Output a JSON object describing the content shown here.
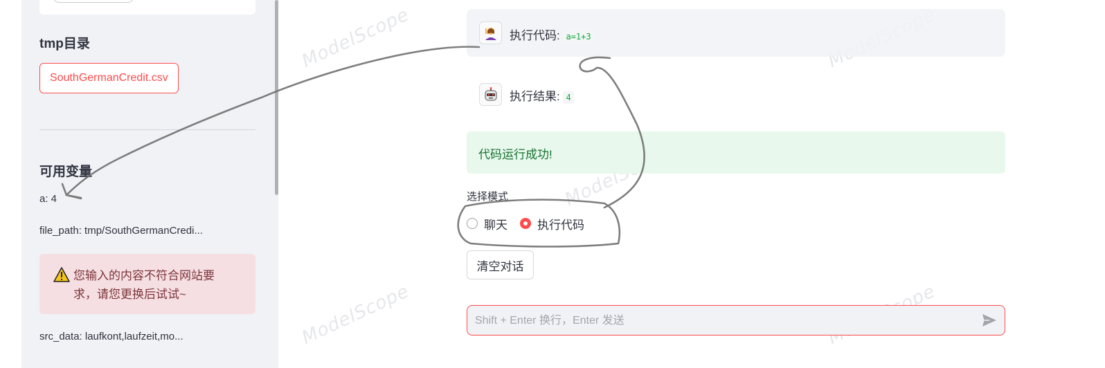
{
  "sidebar": {
    "tmp_heading": "tmp目录",
    "file_chip": "SouthGermanCredit.csv",
    "vars_heading": "可用变量",
    "variables": [
      "a: 4",
      "file_path: tmp/SouthGermanCredi...",
      "src_data: laufkont,laufzeit,mo..."
    ],
    "alert": {
      "icon": "warning-icon",
      "text": "您输入的内容不符合网站要求，请您更换后试试~"
    }
  },
  "chat": {
    "user_message": {
      "label": "执行代码:",
      "code": "a=1+3",
      "avatar": "person-icon"
    },
    "assistant_message": {
      "label": "执行结果:",
      "code": "4",
      "avatar": "robot-icon"
    },
    "success_text": "代码运行成功!"
  },
  "mode": {
    "label": "选择模式",
    "options": [
      "聊天",
      "执行代码"
    ],
    "selected": "执行代码"
  },
  "clear_button": "清空对话",
  "input": {
    "placeholder": "Shift + Enter 换行，Enter 发送",
    "value": ""
  },
  "watermark_text": "ModelScope",
  "colors": {
    "accent": "#ff4b4b",
    "sidebar_bg": "#f0f2f6",
    "success_bg": "#e8f8ec",
    "success_text": "#177233",
    "alert_bg": "#f5dfe2",
    "alert_text": "#7d353b",
    "code_green": "#09ab3b"
  }
}
